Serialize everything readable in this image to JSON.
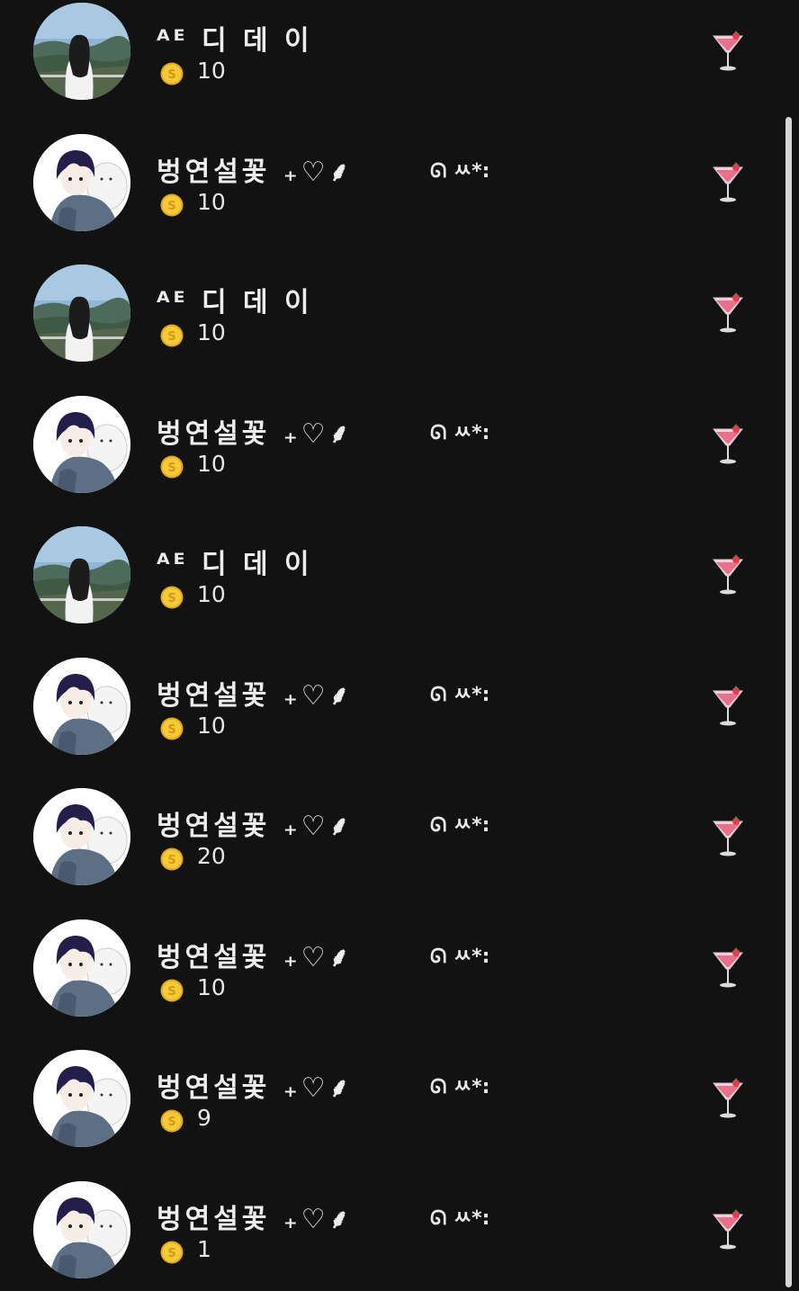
{
  "rows": [
    {
      "user": "ᴬᴱ 디 데 이",
      "status": "",
      "amount": "10",
      "avatar": "girl-landscape"
    },
    {
      "user": "벙연설꽃 ₊♡⸙",
      "status": "ᘏ ㅆ*:",
      "amount": "10",
      "avatar": "anime-boy"
    },
    {
      "user": "ᴬᴱ 디 데 이",
      "status": "",
      "amount": "10",
      "avatar": "girl-landscape"
    },
    {
      "user": "벙연설꽃 ₊♡⸙",
      "status": "ᘏ ㅆ*:",
      "amount": "10",
      "avatar": "anime-boy"
    },
    {
      "user": "ᴬᴱ 디 데 이",
      "status": "",
      "amount": "10",
      "avatar": "girl-landscape"
    },
    {
      "user": "벙연설꽃 ₊♡⸙",
      "status": "ᘏ ㅆ*:",
      "amount": "10",
      "avatar": "anime-boy"
    },
    {
      "user": "벙연설꽃 ₊♡⸙",
      "status": "ᘏ ㅆ*:",
      "amount": "20",
      "avatar": "anime-boy"
    },
    {
      "user": "벙연설꽃 ₊♡⸙",
      "status": "ᘏ ㅆ*:",
      "amount": "10",
      "avatar": "anime-boy"
    },
    {
      "user": "벙연설꽃 ₊♡⸙",
      "status": "ᘏ ㅆ*:",
      "amount": "9",
      "avatar": "anime-boy"
    },
    {
      "user": "벙연설꽃 ₊♡⸙",
      "status": "ᘏ ㅆ*:",
      "amount": "1",
      "avatar": "anime-boy"
    }
  ],
  "icons": {
    "coin": "gold-coin-icon",
    "gift": "cocktail-icon"
  },
  "colors": {
    "background": "#121212",
    "coin": "#f2c230",
    "cocktail": "#e8708a"
  }
}
